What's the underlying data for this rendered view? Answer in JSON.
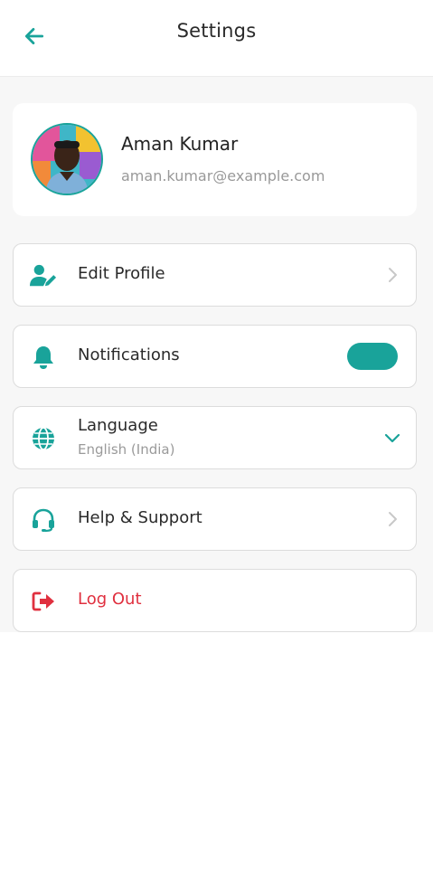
{
  "header": {
    "title": "Settings"
  },
  "profile": {
    "name": "Aman Kumar",
    "email": "aman.kumar@example.com"
  },
  "menu": {
    "edit_profile": "Edit Profile",
    "notifications": {
      "label": "Notifications",
      "enabled": true
    },
    "language": {
      "label": "Language",
      "value": "English (India)"
    },
    "help": "Help & Support",
    "logout": "Log Out"
  },
  "colors": {
    "accent": "#19a39a",
    "danger": "#e0303f",
    "chevron": "#c8c8c8"
  },
  "icons": {
    "back": "arrow-left-icon",
    "edit_profile": "user-edit-icon",
    "notifications": "bell-icon",
    "language": "globe-icon",
    "help": "headset-icon",
    "logout": "sign-out-icon"
  }
}
